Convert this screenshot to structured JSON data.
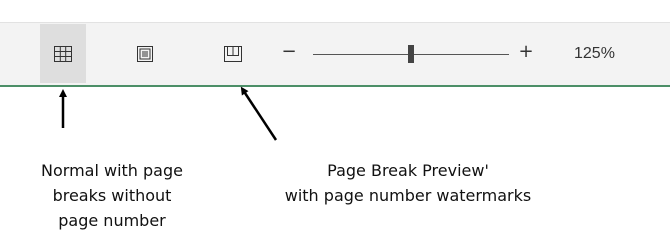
{
  "statusbar": {
    "view_buttons": [
      {
        "name": "Normal",
        "icon": "grid-icon",
        "active": true
      },
      {
        "name": "Page Layout",
        "icon": "page-layout-icon",
        "active": false
      },
      {
        "name": "Page Break Preview",
        "icon": "page-break-preview-icon",
        "active": false
      }
    ],
    "zoom": {
      "minus_label": "−",
      "plus_label": "+",
      "level_text": "125%",
      "slider_fraction": 0.5
    },
    "accent_line_color": "#4c8f67"
  },
  "annotations": {
    "left": {
      "lines": [
        "Normal with page",
        "breaks without",
        "page number"
      ]
    },
    "right": {
      "lines": [
        "Page Break Preview'",
        "with page number watermarks"
      ]
    }
  }
}
